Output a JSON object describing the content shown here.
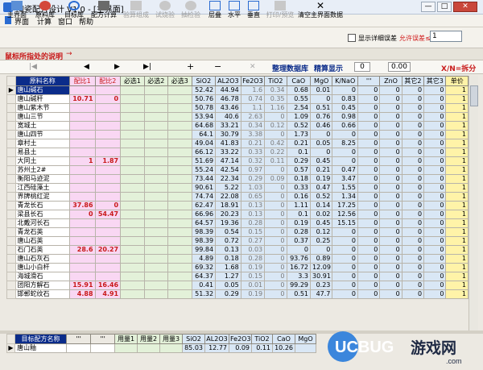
{
  "window": {
    "title": "陶瓷配方设计 V1.0 - [主界面]",
    "min": "—",
    "max": "□",
    "close": "✕"
  },
  "menu": [
    "界面",
    "计算",
    "窗口",
    "帮助"
  ],
  "toolbar": {
    "buttons": [
      "主界面",
      "原料库",
      "目标库",
      "配方计算",
      "验算组成",
      "试烧验",
      "抽检验",
      "层叠",
      "水平",
      "垂直",
      "打印/预览",
      "清空主界面数据"
    ],
    "show_detail_label": "显示详细误差",
    "error_label": "允许误差≤",
    "error_value": "1"
  },
  "hint": {
    "text": "鼠标所指处的说明",
    "arrow": "→"
  },
  "nav": {
    "first": "|◀",
    "prev": "◀",
    "next": "▶",
    "last": "▶|",
    "add": "+",
    "remove": "−",
    "check": "✓",
    "cancel": "✕",
    "refresh": "↻",
    "db_label": "整理数据库",
    "calc_label": "精算显示",
    "zero1": "0",
    "zero2": "0.00",
    "split_label": "X/N=拆分"
  },
  "columns": [
    "原料名称",
    "配比1",
    "配比2",
    "必选1",
    "必选2",
    "必选3",
    "SiO2",
    "AL2O3",
    "Fe2O3",
    "TiO2",
    "CaO",
    "MgO",
    "K/NaO",
    "'''",
    "ZnO",
    "其它2",
    "其它3",
    "单价"
  ],
  "rows": [
    [
      "唐山碱石",
      "",
      "",
      "",
      "",
      "",
      "52.42",
      "44.94",
      "1.6",
      "0.34",
      "0.68",
      "0.01",
      "0",
      "0",
      "0",
      "0",
      "0",
      "1"
    ],
    [
      "唐山碱秆",
      "10.71",
      "0",
      "",
      "",
      "",
      "50.76",
      "46.78",
      "0.74",
      "0.35",
      "0.55",
      "0",
      "0.83",
      "0",
      "0",
      "0",
      "0",
      "1"
    ],
    [
      "唐山紫木节",
      "",
      "",
      "",
      "",
      "",
      "50.78",
      "43.46",
      "1.1",
      "1.16",
      "2.54",
      "0.51",
      "0.45",
      "0",
      "0",
      "0",
      "0",
      "1"
    ],
    [
      "唐山三节",
      "",
      "",
      "",
      "",
      "",
      "53.94",
      "40.6",
      "2.63",
      "0",
      "1.09",
      "0.76",
      "0.98",
      "0",
      "0",
      "0",
      "0",
      "1"
    ],
    [
      "宽城土",
      "",
      "",
      "",
      "",
      "",
      "64.68",
      "33.21",
      "0.34",
      "0.12",
      "0.52",
      "0.46",
      "0.66",
      "0",
      "0",
      "0",
      "0",
      "1"
    ],
    [
      "唐山四节",
      "",
      "",
      "",
      "",
      "",
      "64.1",
      "30.79",
      "3.38",
      "0",
      "1.73",
      "0",
      "0",
      "0",
      "0",
      "0",
      "0",
      "1"
    ],
    [
      "章村土",
      "",
      "",
      "",
      "",
      "",
      "49.04",
      "41.83",
      "0.21",
      "0.42",
      "0.21",
      "0.05",
      "8.25",
      "0",
      "0",
      "0",
      "0",
      "1"
    ],
    [
      "易县土",
      "",
      "",
      "",
      "",
      "",
      "66.12",
      "33.22",
      "0.33",
      "0.22",
      "0.1",
      "0",
      "0",
      "0",
      "0",
      "0",
      "0",
      "1"
    ],
    [
      "大同土",
      "1",
      "1.87",
      "",
      "",
      "",
      "51.69",
      "47.14",
      "0.32",
      "0.11",
      "0.29",
      "0.45",
      "0",
      "0",
      "0",
      "0",
      "0",
      "1"
    ],
    [
      " 苏州土2#",
      "",
      "",
      "",
      "",
      "",
      "55.24",
      "42.54",
      "0.97",
      "0",
      "0.57",
      "0.21",
      "0.47",
      "0",
      "0",
      "0",
      "0",
      "1"
    ],
    [
      "衡阳马迹泥",
      "",
      "",
      "",
      "",
      "",
      "73.44",
      "22.34",
      "0.29",
      "0.09",
      "0.18",
      "0.19",
      "3.47",
      "0",
      "0",
      "0",
      "0",
      "1"
    ],
    [
      "江西硅藻土",
      "",
      "",
      "",
      "",
      "",
      "90.61",
      "5.22",
      "1.03",
      "0",
      "0.33",
      "0.47",
      "1.55",
      "0",
      "0",
      "0",
      "0",
      "1"
    ],
    [
      "界牌桃红泥",
      "",
      "",
      "",
      "",
      "",
      "74.74",
      "22.08",
      "0.65",
      "0",
      "0.16",
      "0.52",
      "1.34",
      "0",
      "0",
      "0",
      "0",
      "1"
    ],
    [
      "青龙长石",
      "37.86",
      "0",
      "",
      "",
      "",
      "62.47",
      "18.91",
      "0.13",
      "0",
      "1.11",
      "0.14",
      "17.25",
      "0",
      "0",
      "0",
      "0",
      "1"
    ],
    [
      "梁县长石",
      "0",
      "54.47",
      "",
      "",
      "",
      "66.96",
      "20.23",
      "0.13",
      "0",
      "0.1",
      "0.02",
      "12.56",
      "0",
      "0",
      "0",
      "0",
      "1"
    ],
    [
      "北戴河长石",
      "",
      "",
      "",
      "",
      "",
      "64.57",
      "19.36",
      "0.28",
      "0",
      "0.19",
      "0.45",
      "15.15",
      "0",
      "0",
      "0",
      "0",
      "1"
    ],
    [
      "青龙石英",
      "",
      "",
      "",
      "",
      "",
      "98.39",
      "0.54",
      "0.15",
      "0",
      "0.28",
      "0.12",
      "0",
      "0",
      "0",
      "0",
      "0",
      "1"
    ],
    [
      "唐山石英",
      "",
      "",
      "",
      "",
      "",
      "98.39",
      "0.72",
      "0.27",
      "0",
      "0.37",
      "0.25",
      "0",
      "0",
      "0",
      "0",
      "0",
      "1"
    ],
    [
      "石门石英",
      "28.6",
      "20.27",
      "",
      "",
      "",
      "99.84",
      "0.13",
      "0.03",
      "0",
      "0",
      "0",
      "0",
      "0",
      "0",
      "0",
      "0",
      "1"
    ],
    [
      "唐山石灰石",
      "",
      "",
      "",
      "",
      "",
      "4.89",
      "0.18",
      "0.28",
      "0",
      "93.76",
      "0.89",
      "0",
      "0",
      "0",
      "0",
      "0",
      "1"
    ],
    [
      "唐山小白杆",
      "",
      "",
      "",
      "",
      "",
      "69.32",
      "1.68",
      "0.19",
      "0",
      "16.72",
      "12.09",
      "0",
      "0",
      "0",
      "0",
      "0",
      "1"
    ],
    [
      "海城滑石",
      "",
      "",
      "",
      "",
      "",
      "64.37",
      "1.27",
      "0.15",
      "0",
      "3.3",
      "30.91",
      "0",
      "0",
      "0",
      "0",
      "0",
      "1"
    ],
    [
      "团阳方解石",
      "15.91",
      "16.46",
      "",
      "",
      "",
      "0.41",
      "0.05",
      "0.01",
      "0",
      "99.29",
      "0.23",
      "0",
      "0",
      "0",
      "0",
      "0",
      "1"
    ],
    [
      "邯郸蛇纹石",
      "4.88",
      "4.91",
      "",
      "",
      "",
      "51.32",
      "0.29",
      "0.19",
      "0",
      "0.51",
      "47.7",
      "0",
      "0",
      "0",
      "0",
      "0",
      "1"
    ]
  ],
  "target": {
    "columns": [
      "目标配方名称",
      "'''",
      "'''",
      "用量1",
      "用量2",
      "用量3",
      "SiO2",
      "AL2O3",
      "Fe2O3",
      "TiO2",
      "CaO",
      "MgO"
    ],
    "row": [
      "唐山釉",
      "",
      "",
      "",
      "",
      "",
      "85.03",
      "12.77",
      "0.09",
      "0.11",
      "10.26",
      ""
    ]
  },
  "watermark": {
    "brand": "UCBUG",
    "suffix": "游戏网",
    ".com": ".com"
  },
  "colors": {
    "selected": "#0b2c8a",
    "pink": "#f9d7f3",
    "green": "#e3f1d9",
    "blue": "#d9e7f5",
    "yellow": "#fff3a8"
  }
}
